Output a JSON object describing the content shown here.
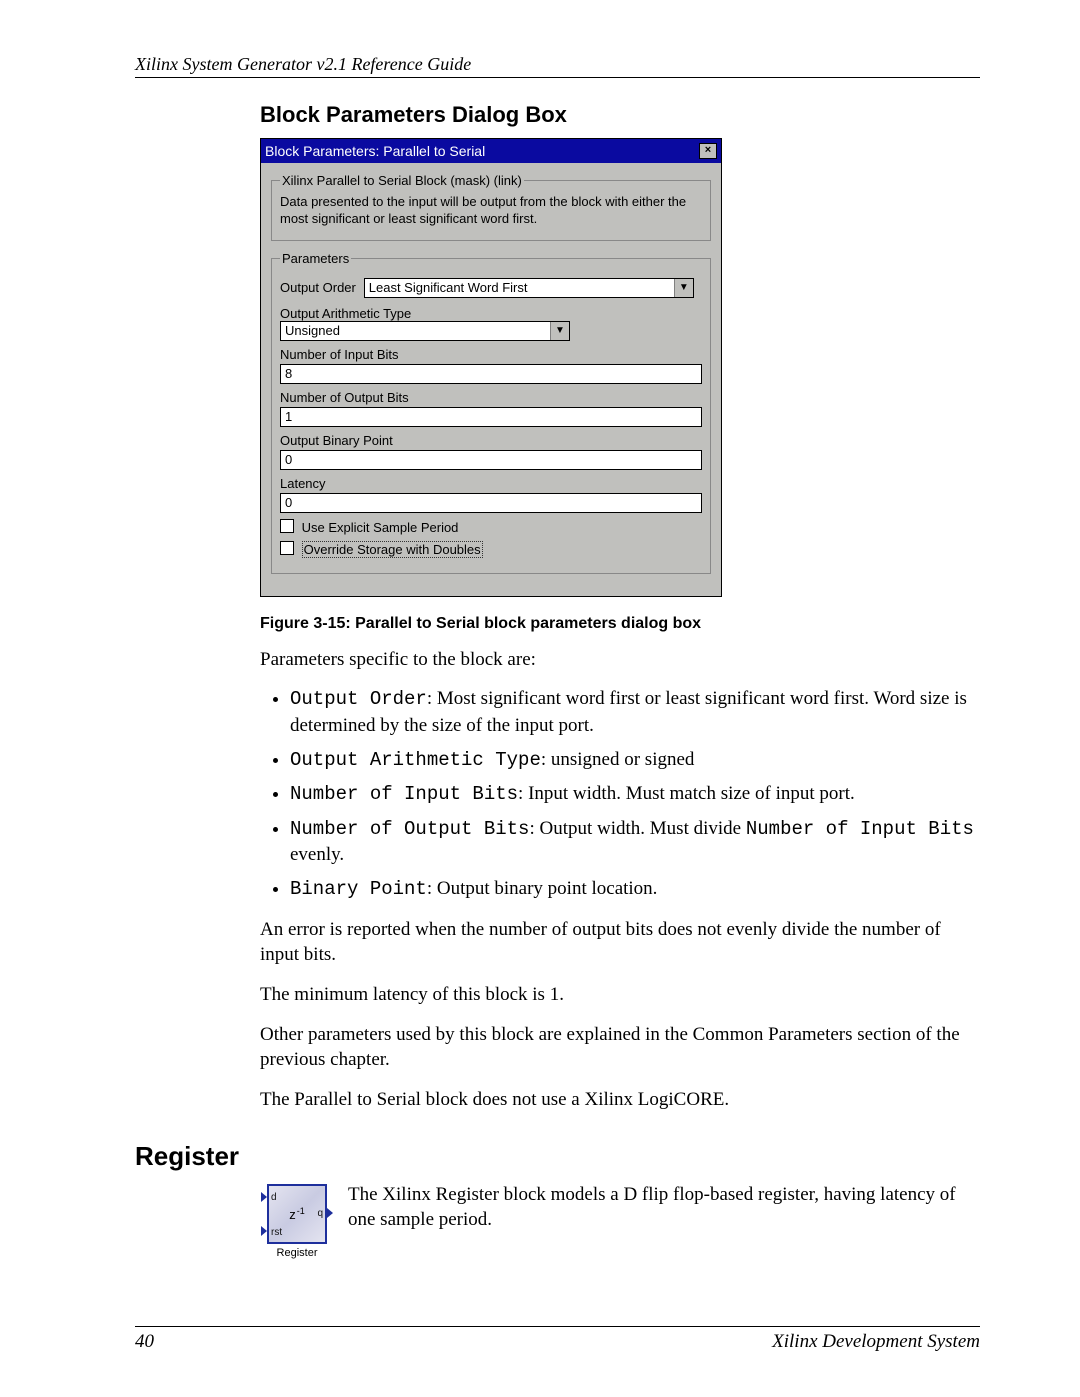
{
  "header": {
    "title": "Xilinx System Generator v2.1 Reference Guide"
  },
  "section": {
    "title": "Block Parameters Dialog Box"
  },
  "dialog": {
    "title": "Block Parameters: Parallel to Serial",
    "group_title": "Xilinx Parallel to Serial Block (mask) (link)",
    "description": "Data presented to the input will be output from the block with either the most significant or least significant word first.",
    "params_legend": "Parameters",
    "output_order_label": "Output Order",
    "output_order_value": "Least Significant Word First",
    "arith_label": "Output Arithmetic Type",
    "arith_value": "Unsigned",
    "nin_label": "Number of Input Bits",
    "nin_value": "8",
    "nout_label": "Number of Output Bits",
    "nout_value": "1",
    "bp_label": "Output Binary Point",
    "bp_value": "0",
    "lat_label": "Latency",
    "lat_value": "0",
    "cb1": "Use Explicit Sample Period",
    "cb2": "Override Storage with Doubles"
  },
  "caption": "Figure 3-15:   Parallel to Serial block parameters dialog box",
  "intro": "Parameters specific to the block are:",
  "bullets": {
    "b1a": "Output Order",
    "b1b": ": Most significant word first or least significant word first. Word size is determined by the size of the input port.",
    "b2a": "Output Arithmetic Type",
    "b2b": ": unsigned or signed",
    "b3a": "Number of Input Bits",
    "b3b": ": Input width.  Must match size of input port.",
    "b4a": "Number of Output Bits",
    "b4b": ": Output width.  Must divide ",
    "b4c": "Number of Input Bits",
    "b4d": " evenly.",
    "b5a": "Binary Point",
    "b5b": ": Output binary point location."
  },
  "p1": "An error is reported when the number of output bits does not evenly divide the number of input bits.",
  "p2": "The minimum latency of this block is 1.",
  "p3": "Other parameters used by this block are explained in the Common Parameters section of the previous chapter.",
  "p4": "The Parallel to Serial block does not use a Xilinx LogiCORE.",
  "h2": "Register",
  "reg": {
    "d": "d",
    "q": "q",
    "rst": "rst",
    "z": "z",
    "exp": "-1",
    "caption": "Register",
    "text": "The Xilinx Register block models a D flip flop-based register, having latency of one sample period."
  },
  "footer": {
    "page": "40",
    "right": "Xilinx Development System"
  }
}
